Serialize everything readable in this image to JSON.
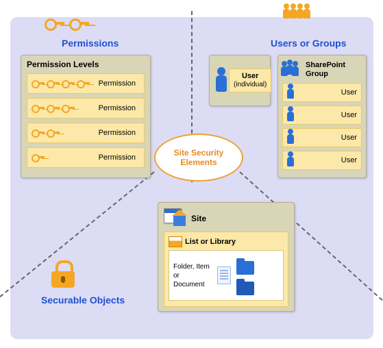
{
  "center": {
    "label": "Site Security Elements"
  },
  "permissions": {
    "title": "Permissions",
    "panel_title": "Permission Levels",
    "rows": [
      {
        "key_count": 4,
        "label": "Permission"
      },
      {
        "key_count": 3,
        "label": "Permission"
      },
      {
        "key_count": 2,
        "label": "Permission"
      },
      {
        "key_count": 1,
        "label": "Permission"
      }
    ]
  },
  "users_groups": {
    "title": "Users or Groups",
    "user_panel": {
      "title": "User",
      "subtitle": "(individual)"
    },
    "sp_group": {
      "title": "SharePoint Group",
      "rows": [
        {
          "label": "User"
        },
        {
          "label": "User"
        },
        {
          "label": "User"
        },
        {
          "label": "User"
        }
      ]
    }
  },
  "securable": {
    "title": "Securable Objects",
    "site_label": "Site",
    "list_label": "List or Library",
    "folder_label": "Folder, Item or Document"
  }
}
